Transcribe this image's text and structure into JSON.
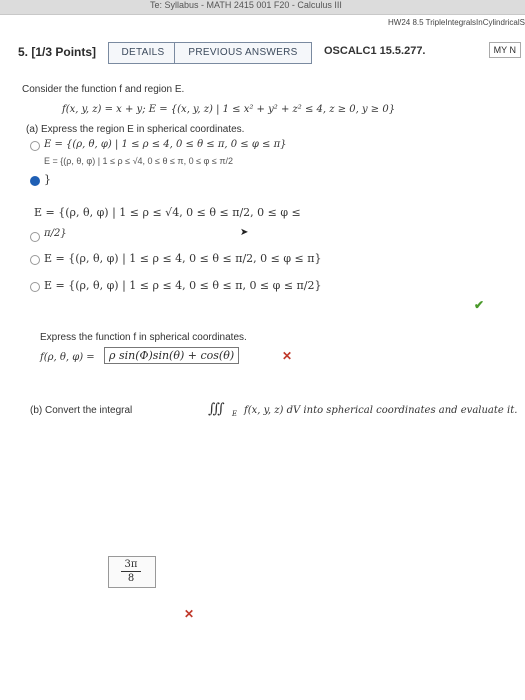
{
  "browser": {
    "top_text": "Te: Syllabus - MATH 2415 001 F20 - Calculus III",
    "top_right": "HW24 8.5 TripleIntegralsInCylindricalS..."
  },
  "question": {
    "number": "5. [1/3 Points]",
    "details_label": "DETAILS",
    "previous_label": "PREVIOUS ANSWERS",
    "course": "OSCALC1 15.5.277.",
    "my_notes": "MY N"
  },
  "prompt": {
    "intro": "Consider the function f and region E.",
    "def": "f(x, y, z) = x + y; E = {(x, y, z) | 1 ≤ x² + y² + z² ≤ 4, z ≥ 0, y ≥ 0}"
  },
  "part_a": {
    "label": "(a)  Express the region E in spherical coordinates.",
    "options": [
      "E = {(ρ, θ, φ) | 1 ≤ ρ ≤ 4, 0 ≤ θ ≤ π, 0 ≤ φ ≤ π}",
      "E = {(ρ, θ, φ) | 1 ≤ ρ ≤ √4, 0 ≤ θ ≤ π, 0 ≤ φ ≤ π/2",
      "E = {(ρ, θ, φ) | 1 ≤ ρ ≤ √4, 0 ≤ θ ≤ π/2, 0 ≤ φ ≤",
      "E = {(ρ, θ, φ) | 1 ≤ ρ ≤ 4, 0 ≤ θ ≤ π/2, 0 ≤ φ ≤ π}",
      "E = {(ρ, θ, φ) | 1 ≤ ρ ≤ 4, 0 ≤ θ ≤ π, 0 ≤ φ ≤ π/2}"
    ],
    "cont_1": "}",
    "cont_2": "π/2}",
    "express_f": "Express the function f in spherical coordinates.",
    "f_prefix": "f(ρ, θ, φ) =",
    "f_answer": "ρ sin(Φ)sin(θ) + cos(θ)"
  },
  "part_b": {
    "label_prefix": "(b)  Convert the integral",
    "integral": "∭",
    "label_suffix": "f(x, y, z) dV into spherical coordinates and evaluate it.",
    "sub_E": "E",
    "answer_num": "3π",
    "answer_den": "8"
  },
  "icons": {
    "correct": "✔",
    "wrong": "✕"
  }
}
